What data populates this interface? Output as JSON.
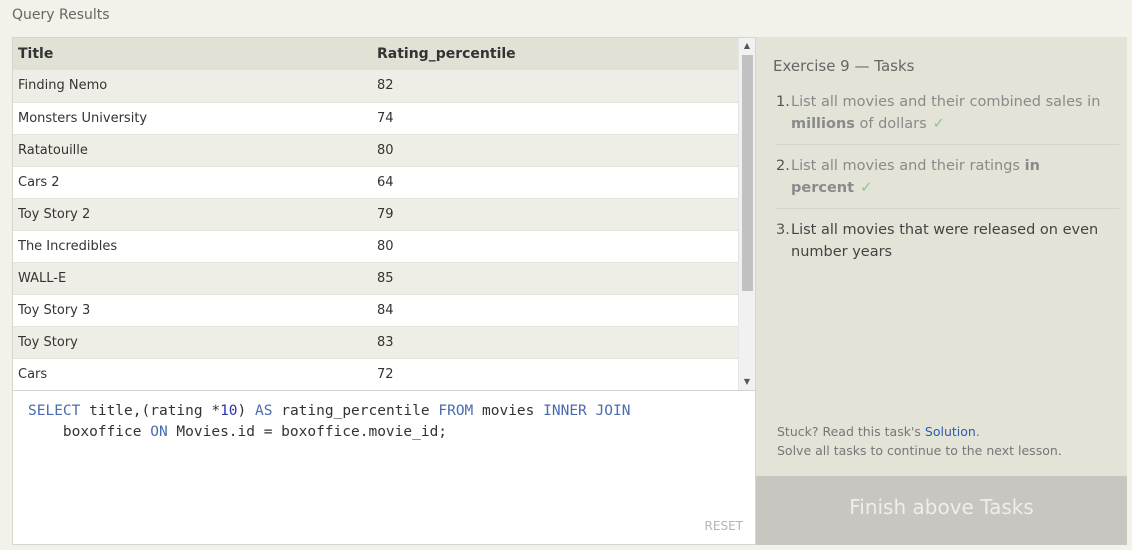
{
  "results": {
    "title": "Query Results",
    "columns": [
      "Title",
      "Rating_percentile"
    ],
    "rows": [
      [
        "Finding Nemo",
        "82"
      ],
      [
        "Monsters University",
        "74"
      ],
      [
        "Ratatouille",
        "80"
      ],
      [
        "Cars 2",
        "64"
      ],
      [
        "Toy Story 2",
        "79"
      ],
      [
        "The Incredibles",
        "80"
      ],
      [
        "WALL-E",
        "85"
      ],
      [
        "Toy Story 3",
        "84"
      ],
      [
        "Toy Story",
        "83"
      ],
      [
        "Cars",
        "72"
      ]
    ]
  },
  "editor": {
    "code_tokens": {
      "select": "SELECT",
      "part1": " title,(rating *",
      "ten": "10",
      "part2": ") ",
      "as": "AS",
      "part3": " rating_percentile ",
      "from": "FROM",
      "part4": " movies ",
      "inner_join": "INNER JOIN",
      "part5": "\n    boxoffice ",
      "on": "ON",
      "part6": " Movies.id = boxoffice.movie_id;"
    },
    "reset_label": "RESET"
  },
  "tasks": {
    "heading": "Exercise 9 — Tasks",
    "items": [
      {
        "num": "1.",
        "text_a": "List all movies and their combined sales in ",
        "bold": "millions",
        "text_b": " of dollars",
        "check": "✓"
      },
      {
        "num": "2.",
        "text_a": "List all movies and their ratings ",
        "bold": "in percent",
        "text_b": "",
        "check": "✓"
      },
      {
        "num": "3.",
        "text_a": "List all movies that were released on even number years",
        "bold": "",
        "text_b": "",
        "check": ""
      }
    ],
    "stuck_prefix": "Stuck? Read this task's ",
    "solution_label": "Solution",
    "stuck_suffix": ".",
    "continue_text": "Solve all tasks to continue to the next lesson.",
    "finish_label": "Finish above Tasks"
  },
  "colors": {
    "keyword": "#4a6bb0",
    "number": "#2a35a6",
    "link": "#2a5db0",
    "check": "#8ec08e"
  }
}
